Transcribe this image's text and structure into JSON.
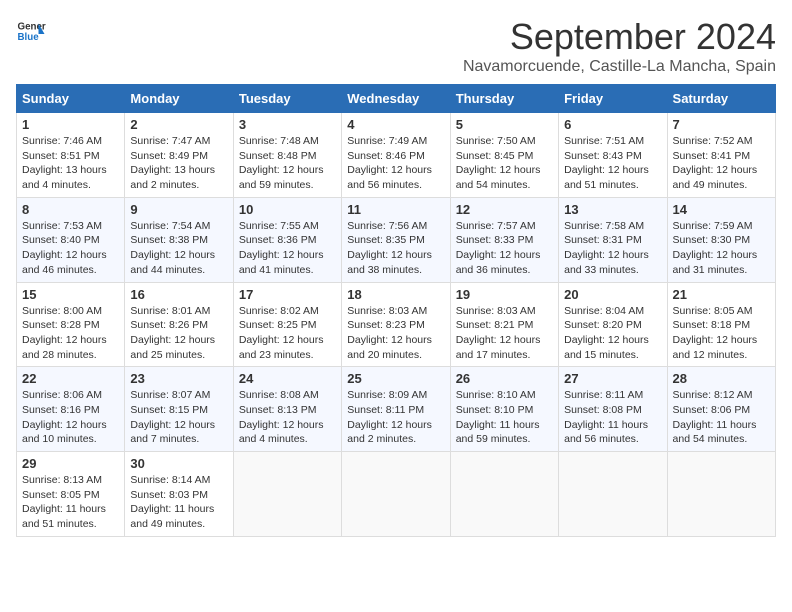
{
  "header": {
    "logo_general": "General",
    "logo_blue": "Blue",
    "month_year": "September 2024",
    "location": "Navamorcuende, Castille-La Mancha, Spain"
  },
  "days_of_week": [
    "Sunday",
    "Monday",
    "Tuesday",
    "Wednesday",
    "Thursday",
    "Friday",
    "Saturday"
  ],
  "weeks": [
    [
      {
        "day": "1",
        "info": "Sunrise: 7:46 AM\nSunset: 8:51 PM\nDaylight: 13 hours\nand 4 minutes."
      },
      {
        "day": "2",
        "info": "Sunrise: 7:47 AM\nSunset: 8:49 PM\nDaylight: 13 hours\nand 2 minutes."
      },
      {
        "day": "3",
        "info": "Sunrise: 7:48 AM\nSunset: 8:48 PM\nDaylight: 12 hours\nand 59 minutes."
      },
      {
        "day": "4",
        "info": "Sunrise: 7:49 AM\nSunset: 8:46 PM\nDaylight: 12 hours\nand 56 minutes."
      },
      {
        "day": "5",
        "info": "Sunrise: 7:50 AM\nSunset: 8:45 PM\nDaylight: 12 hours\nand 54 minutes."
      },
      {
        "day": "6",
        "info": "Sunrise: 7:51 AM\nSunset: 8:43 PM\nDaylight: 12 hours\nand 51 minutes."
      },
      {
        "day": "7",
        "info": "Sunrise: 7:52 AM\nSunset: 8:41 PM\nDaylight: 12 hours\nand 49 minutes."
      }
    ],
    [
      {
        "day": "8",
        "info": "Sunrise: 7:53 AM\nSunset: 8:40 PM\nDaylight: 12 hours\nand 46 minutes."
      },
      {
        "day": "9",
        "info": "Sunrise: 7:54 AM\nSunset: 8:38 PM\nDaylight: 12 hours\nand 44 minutes."
      },
      {
        "day": "10",
        "info": "Sunrise: 7:55 AM\nSunset: 8:36 PM\nDaylight: 12 hours\nand 41 minutes."
      },
      {
        "day": "11",
        "info": "Sunrise: 7:56 AM\nSunset: 8:35 PM\nDaylight: 12 hours\nand 38 minutes."
      },
      {
        "day": "12",
        "info": "Sunrise: 7:57 AM\nSunset: 8:33 PM\nDaylight: 12 hours\nand 36 minutes."
      },
      {
        "day": "13",
        "info": "Sunrise: 7:58 AM\nSunset: 8:31 PM\nDaylight: 12 hours\nand 33 minutes."
      },
      {
        "day": "14",
        "info": "Sunrise: 7:59 AM\nSunset: 8:30 PM\nDaylight: 12 hours\nand 31 minutes."
      }
    ],
    [
      {
        "day": "15",
        "info": "Sunrise: 8:00 AM\nSunset: 8:28 PM\nDaylight: 12 hours\nand 28 minutes."
      },
      {
        "day": "16",
        "info": "Sunrise: 8:01 AM\nSunset: 8:26 PM\nDaylight: 12 hours\nand 25 minutes."
      },
      {
        "day": "17",
        "info": "Sunrise: 8:02 AM\nSunset: 8:25 PM\nDaylight: 12 hours\nand 23 minutes."
      },
      {
        "day": "18",
        "info": "Sunrise: 8:03 AM\nSunset: 8:23 PM\nDaylight: 12 hours\nand 20 minutes."
      },
      {
        "day": "19",
        "info": "Sunrise: 8:03 AM\nSunset: 8:21 PM\nDaylight: 12 hours\nand 17 minutes."
      },
      {
        "day": "20",
        "info": "Sunrise: 8:04 AM\nSunset: 8:20 PM\nDaylight: 12 hours\nand 15 minutes."
      },
      {
        "day": "21",
        "info": "Sunrise: 8:05 AM\nSunset: 8:18 PM\nDaylight: 12 hours\nand 12 minutes."
      }
    ],
    [
      {
        "day": "22",
        "info": "Sunrise: 8:06 AM\nSunset: 8:16 PM\nDaylight: 12 hours\nand 10 minutes."
      },
      {
        "day": "23",
        "info": "Sunrise: 8:07 AM\nSunset: 8:15 PM\nDaylight: 12 hours\nand 7 minutes."
      },
      {
        "day": "24",
        "info": "Sunrise: 8:08 AM\nSunset: 8:13 PM\nDaylight: 12 hours\nand 4 minutes."
      },
      {
        "day": "25",
        "info": "Sunrise: 8:09 AM\nSunset: 8:11 PM\nDaylight: 12 hours\nand 2 minutes."
      },
      {
        "day": "26",
        "info": "Sunrise: 8:10 AM\nSunset: 8:10 PM\nDaylight: 11 hours\nand 59 minutes."
      },
      {
        "day": "27",
        "info": "Sunrise: 8:11 AM\nSunset: 8:08 PM\nDaylight: 11 hours\nand 56 minutes."
      },
      {
        "day": "28",
        "info": "Sunrise: 8:12 AM\nSunset: 8:06 PM\nDaylight: 11 hours\nand 54 minutes."
      }
    ],
    [
      {
        "day": "29",
        "info": "Sunrise: 8:13 AM\nSunset: 8:05 PM\nDaylight: 11 hours\nand 51 minutes."
      },
      {
        "day": "30",
        "info": "Sunrise: 8:14 AM\nSunset: 8:03 PM\nDaylight: 11 hours\nand 49 minutes."
      },
      {
        "day": "",
        "info": ""
      },
      {
        "day": "",
        "info": ""
      },
      {
        "day": "",
        "info": ""
      },
      {
        "day": "",
        "info": ""
      },
      {
        "day": "",
        "info": ""
      }
    ]
  ]
}
